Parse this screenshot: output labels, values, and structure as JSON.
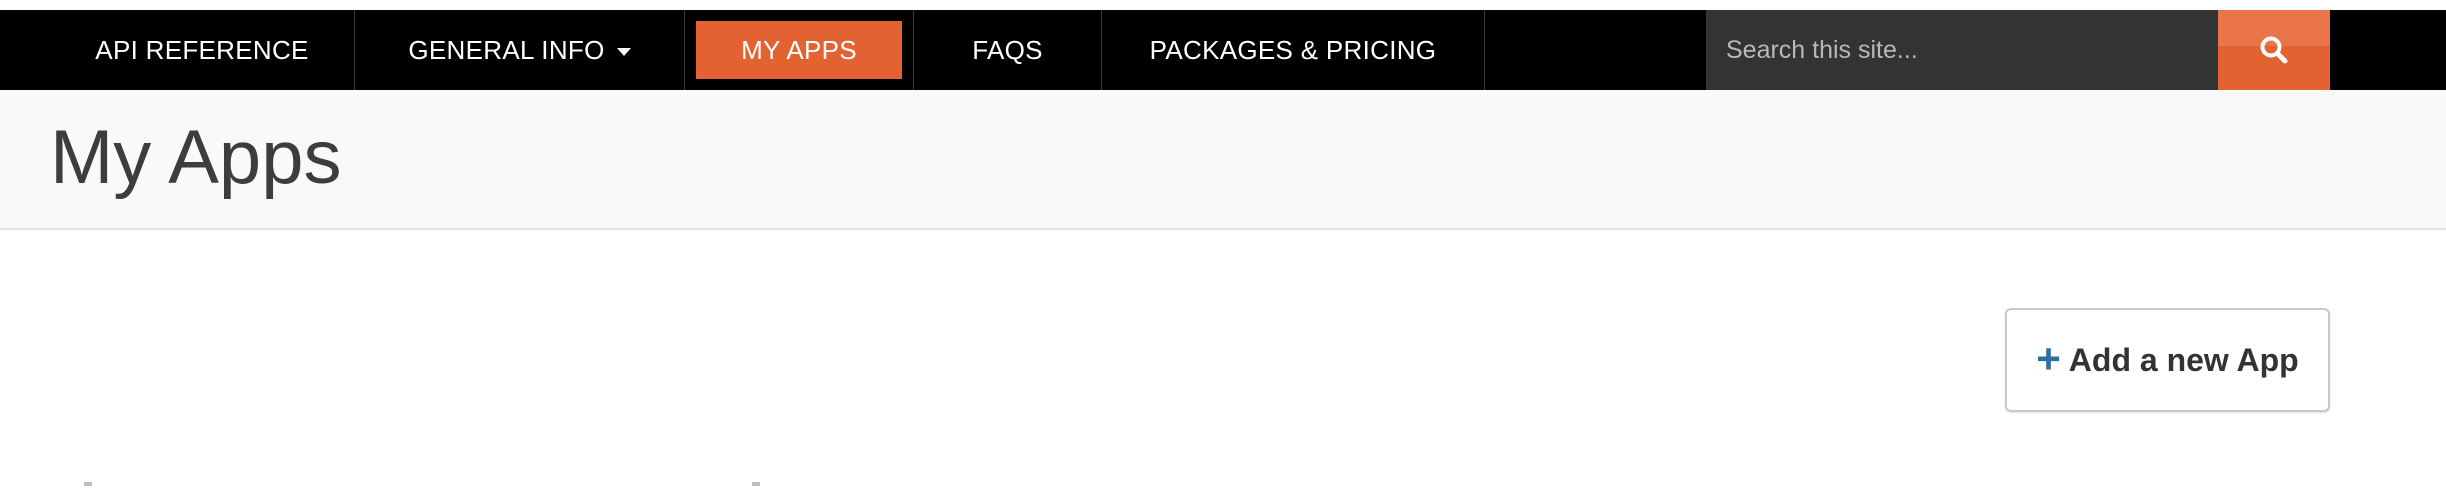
{
  "navbar": {
    "items": [
      {
        "label": "API REFERENCE"
      },
      {
        "label": "GENERAL INFO",
        "has_dropdown": true
      },
      {
        "label": "MY APPS",
        "active": true
      },
      {
        "label": "FAQS"
      },
      {
        "label": "PACKAGES & PRICING"
      }
    ],
    "search": {
      "placeholder": "Search this site...",
      "button_icon": "search-icon"
    }
  },
  "page": {
    "title": "My Apps"
  },
  "actions": {
    "add_app": {
      "icon": "plus-icon",
      "label": "Add a new App"
    }
  },
  "colors": {
    "navbar_bg": "#000000",
    "accent": "#e26232",
    "search_bg": "#333333",
    "header_bg": "#f9f9f9",
    "plus_icon": "#2f6fa0"
  }
}
